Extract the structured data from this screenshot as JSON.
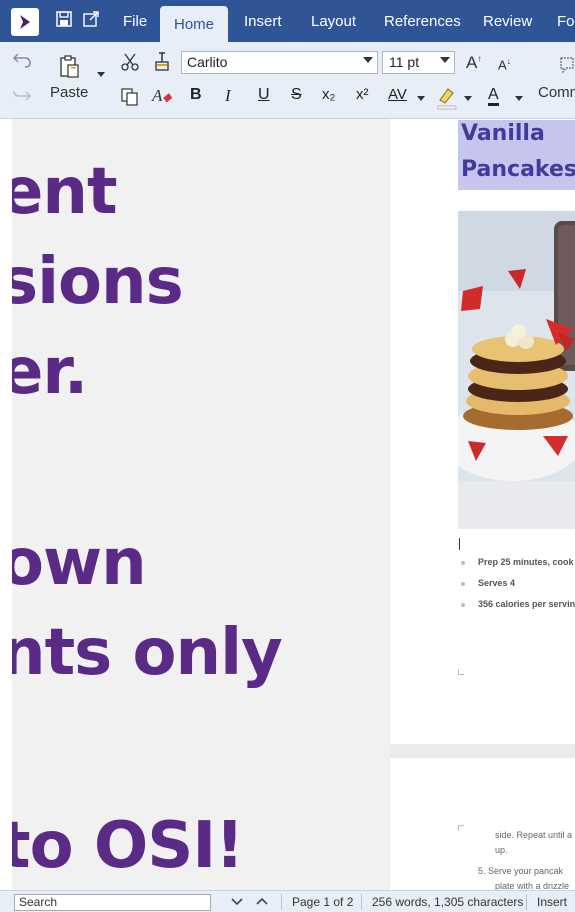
{
  "menu": {
    "items": [
      "File",
      "Home",
      "Insert",
      "Layout",
      "References",
      "Review",
      "For"
    ],
    "active": "Home"
  },
  "ribbon": {
    "paste_label": "Paste",
    "font_name": "Carlito",
    "font_size": "11 pt",
    "comments_label": "Comm",
    "bold": "B",
    "italic": "I",
    "underline": "U",
    "strikethrough": "S",
    "subscript": "x₂",
    "superscript": "x²",
    "grow_font": "A↑",
    "shrink_font": "A↓",
    "char_spacing": "AV",
    "font_color": "A"
  },
  "slide_text": [
    "ent",
    "sions",
    "er.",
    "",
    "own",
    "nts only",
    "",
    "to OSI!"
  ],
  "document": {
    "title_line1": "Vanilla",
    "title_line2": "Pancakes",
    "bullets": [
      "Prep 25 minutes, cook",
      "Serves 4",
      "356 calories per servin"
    ],
    "page2_lines": [
      "side. Repeat until a",
      "up.",
      "5.  Serve your pancak",
      "plate with a drizzle"
    ]
  },
  "status": {
    "search_placeholder": "Search",
    "page": "Page 1 of 2",
    "counts": "256 words, 1,305 characters",
    "mode": "Insert"
  },
  "colors": {
    "menubar": "#2f5596",
    "ribbon": "#e8eef7",
    "slide_text": "#5b2a86",
    "title_highlight": "#c5c5ee",
    "title_text": "#3e3c9c"
  }
}
